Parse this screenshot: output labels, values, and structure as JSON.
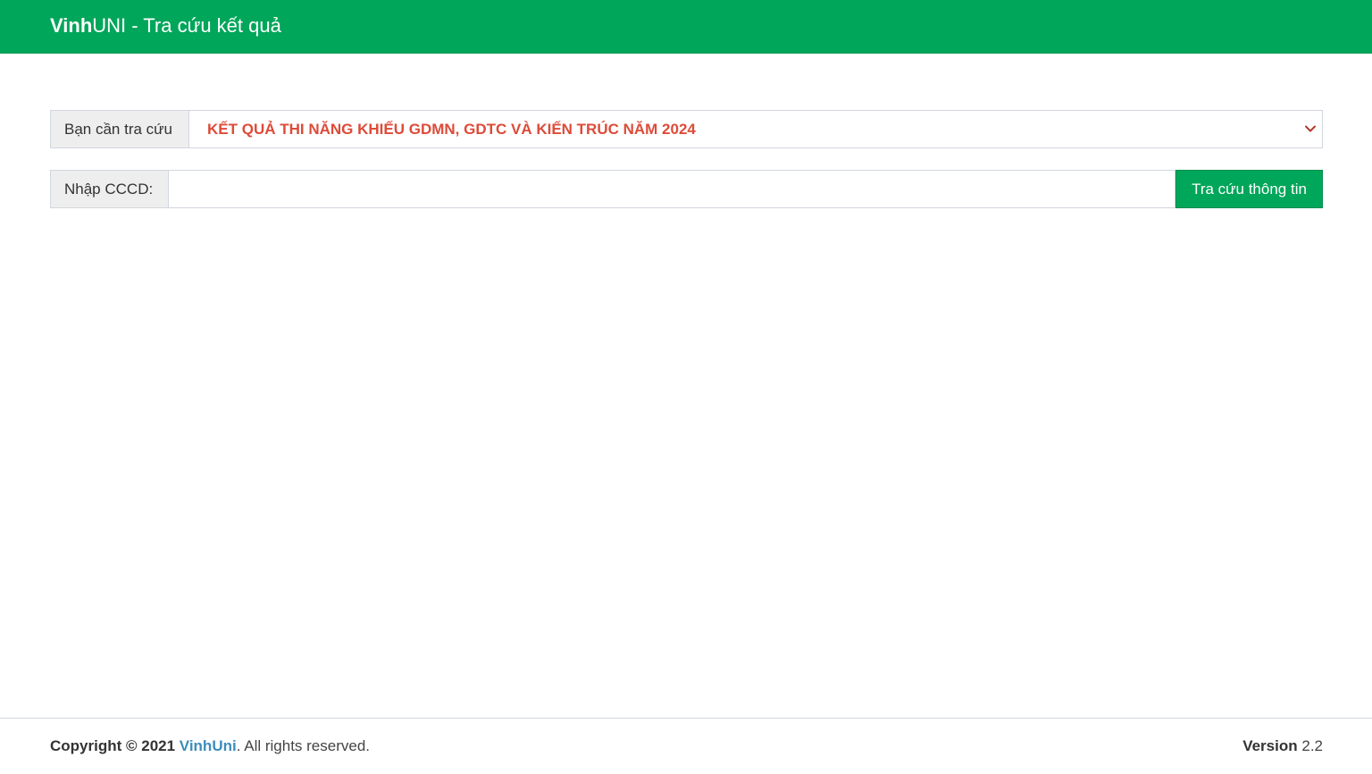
{
  "header": {
    "brand_bold": "Vinh",
    "brand_rest": "UNI - Tra cứu kết quả",
    "bg_color": "#00a65a"
  },
  "search": {
    "select_label": "Bạn cần tra cứu",
    "select_value": "KẾT QUẢ THI NĂNG KHIẾU GDMN, GDTC VÀ KIẾN TRÚC NĂM 2024",
    "select_value_color": "#dd4b39",
    "id_label": "Nhập CCCD:",
    "id_value": "",
    "id_placeholder": "",
    "submit_label": "Tra cứu thông tin"
  },
  "footer": {
    "copyright_prefix": "Copyright © 2021",
    "link_text": "VinhUni",
    "copyright_suffix": ". All rights reserved.",
    "version_label": "Version",
    "version_value": "2.2",
    "link_color": "#3c8dbc"
  }
}
